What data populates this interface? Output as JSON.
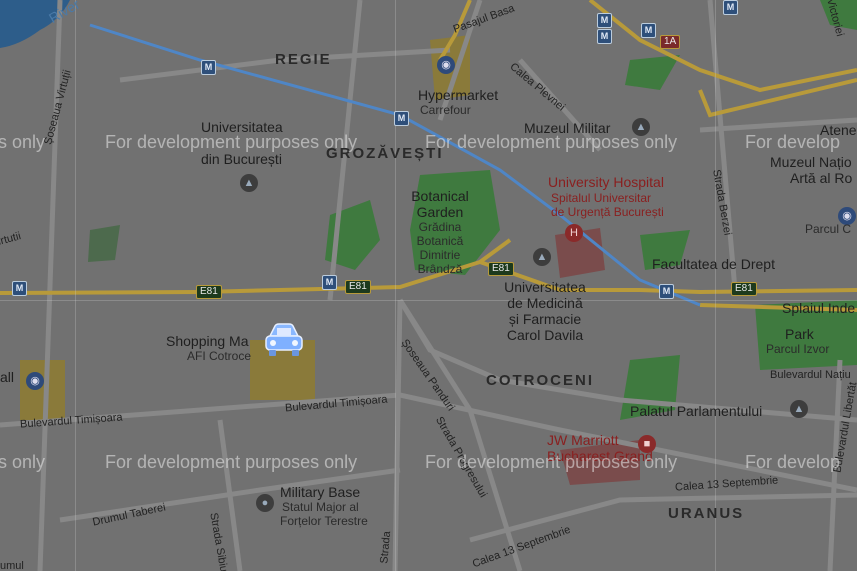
{
  "areas": {
    "regie": "REGIE",
    "grozavesti": "GROZĂVEȘTI",
    "cotroceni": "COTROCENI",
    "uranus": "URANUS"
  },
  "pois": {
    "hypermarket": "Hypermarket",
    "hypermarket_sub": "Carrefour",
    "university_l1": "Universitatea",
    "university_l3": "din București",
    "muzeu_militar": "Muzeul Militar",
    "atene": "Atene",
    "muzeul_nat": "Muzeul Națio",
    "arta_al": "Artă al Ro",
    "univ_hospital": "University Hospital",
    "univ_hospital_sub1": "Spitalul Universitar",
    "univ_hospital_sub2": "de Urgență București",
    "botanical_l1": "Botanical",
    "botanical_l2": "Garden",
    "botanical_sub1": "Grădina",
    "botanical_sub2": "Botanică",
    "botanical_sub3": "Dimitrie",
    "botanical_sub4": "Brândză",
    "facultatea": "Facultatea de Drept",
    "parcul_c": "Parcul C",
    "univ_med_l1": "Universitatea",
    "univ_med_l2": "de Medicină",
    "univ_med_l3": "și Farmacie",
    "univ_med_l4": "Carol Davila",
    "shopping": "Shopping Ma",
    "shopping_sub": "AFI Cotroce",
    "park": "Park",
    "park_sub": "Parcul Izvor",
    "palatul": "Palatul Parlamentului",
    "jw_l1": "JW Marriott",
    "jw_l2": "Bucharest Grand",
    "military_base": "Military Base",
    "military_sub1": "Statul Major al",
    "military_sub2": "Forțelor Terestre",
    "hall": "all"
  },
  "roads": {
    "pasajul_basarab": "Pasajul Basa",
    "calea_plevnei": "Calea Plevnei",
    "soseaua_virtutii": "Șoseaua Virtuții",
    "virtutii2": "irtutii",
    "strada_berzei": "Strada Berzei",
    "splaiul": "Splaiul Inde",
    "bd_timisoara": "Bulevardul Timișoara",
    "bd_timisoara_w": "Bulevardul Timișoara",
    "soseaua_panduri": "Șoseaua Panduri",
    "strada_progresului": "Strada Progresului",
    "calea_13": "Calea 13 Septembrie",
    "calea_13b": "Calea 13 Septembrie",
    "drumul_taberei": "Drumul Taberei",
    "strada_sibiu": "Strada Sibiu",
    "bd_libertatii": "Bulevardul Libertăț",
    "bd_natiunile": "Bulevardul Națiu",
    "victoriei": "Victoriei",
    "river": "River",
    "strada": "Strada",
    "umul": "umul"
  },
  "shields": {
    "e81": "E81",
    "oneA": "1A"
  },
  "metro_label": "M",
  "watermark": "For development purposes only",
  "watermark_left": "s only",
  "watermark_right": "For develop",
  "colors": {
    "base": "#717171",
    "park": "#3f7a3f",
    "highway": "#b89a3a",
    "metro_line": "#4f86c6",
    "water": "#2d5d8a",
    "car": "#7fb0ff"
  }
}
